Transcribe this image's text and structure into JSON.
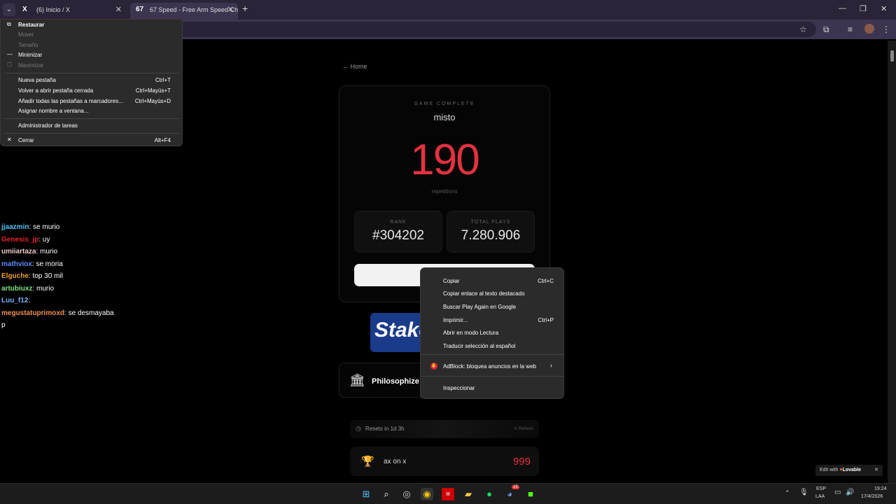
{
  "browser": {
    "tabs": [
      {
        "favicon": "X",
        "title": "(6) Inicio / X"
      },
      {
        "favicon": "67",
        "title": "67 Speed - Free Arm Speed Ch"
      }
    ],
    "new_tab": "+",
    "window_controls": {
      "minimize": "—",
      "maximize": "❐",
      "close": "✕"
    }
  },
  "system_menu": {
    "items": [
      {
        "label": "Restaurar",
        "icon": "restore-icon",
        "enabled": true
      },
      {
        "label": "Mover",
        "enabled": false
      },
      {
        "label": "Tamaño",
        "enabled": false
      },
      {
        "label": "Minimizar",
        "icon": "minimize-icon",
        "enabled": true
      },
      {
        "label": "Maximizar",
        "icon": "maximize-icon",
        "enabled": false
      },
      {
        "label": "Nueva pestaña",
        "shortcut": "Ctrl+T"
      },
      {
        "label": "Volver a abrir pestaña cerrada",
        "shortcut": "Ctrl+Mayús+T"
      },
      {
        "label": "Añadir todas las pestañas a marcadores...",
        "shortcut": "Ctrl+Mayús+D"
      },
      {
        "label": "Asignar nombre a ventana..."
      },
      {
        "label": "Administrador de tareas"
      },
      {
        "label": "Cerrar",
        "icon": "close-icon",
        "shortcut": "Alt+F4"
      }
    ]
  },
  "page": {
    "home_link": "← Home",
    "game_complete": "GAME COMPLETE",
    "player": "misto",
    "score": "190",
    "score_unit": "repetitions",
    "rank_label": "RANK",
    "rank_value": "#304202",
    "plays_label": "TOTAL PLAYS",
    "plays_value": "7.280.906",
    "ad_brand": "Stake",
    "philosophize": "Philosophize M",
    "resets": "Resets in 1d 3h",
    "refresh": "Refresh",
    "leaderboard": [
      {
        "name": "ax on x",
        "score": "999"
      }
    ],
    "lovable": {
      "prefix": "Edit with",
      "brand": "Lovable",
      "close": "✕"
    }
  },
  "chat": [
    {
      "user": "jjaazmin",
      "color": "#4fc3f7",
      "message": " se murio"
    },
    {
      "user": "Genesis_jp",
      "color": "#e3242b",
      "message": " uy"
    },
    {
      "user": "umiiartaza",
      "color": "#f0c8c8",
      "message": " murio"
    },
    {
      "user": "mathviox",
      "color": "#5a8cff",
      "message": " se moria"
    },
    {
      "user": "Elguche",
      "color": "#f0a030",
      "message": " top 30 mil"
    },
    {
      "user": "artubiuxz",
      "color": "#7fe07f",
      "message": " murio"
    },
    {
      "user": "Luu_f12",
      "color": "#7ab8ff",
      "message": ""
    },
    {
      "user": "megustatuprimoxd",
      "color": "#f09050",
      "message": " se desmayaba"
    },
    {
      "user": "",
      "color": "#fff",
      "message": "p"
    }
  ],
  "context_menu": {
    "items": [
      {
        "label": "Copiar",
        "shortcut": "Ctrl+C"
      },
      {
        "label": "Copiar enlace al texto destacado"
      },
      {
        "label": "Buscar Play Again en Google"
      },
      {
        "label": "Imprimir...",
        "shortcut": "Ctrl+P"
      },
      {
        "label": "Abrir en modo Lectura"
      },
      {
        "label": "Traducir selección al español"
      },
      {
        "label": "AdBlock: bloquea anuncios en la web",
        "icon": "adblock-icon",
        "submenu": "›"
      },
      {
        "label": "Inspeccionar"
      }
    ]
  },
  "taskbar": {
    "lang": "ESP",
    "layout": "LAA",
    "time": "19:24",
    "date": "17/4/2026",
    "discord_badge": "15"
  }
}
